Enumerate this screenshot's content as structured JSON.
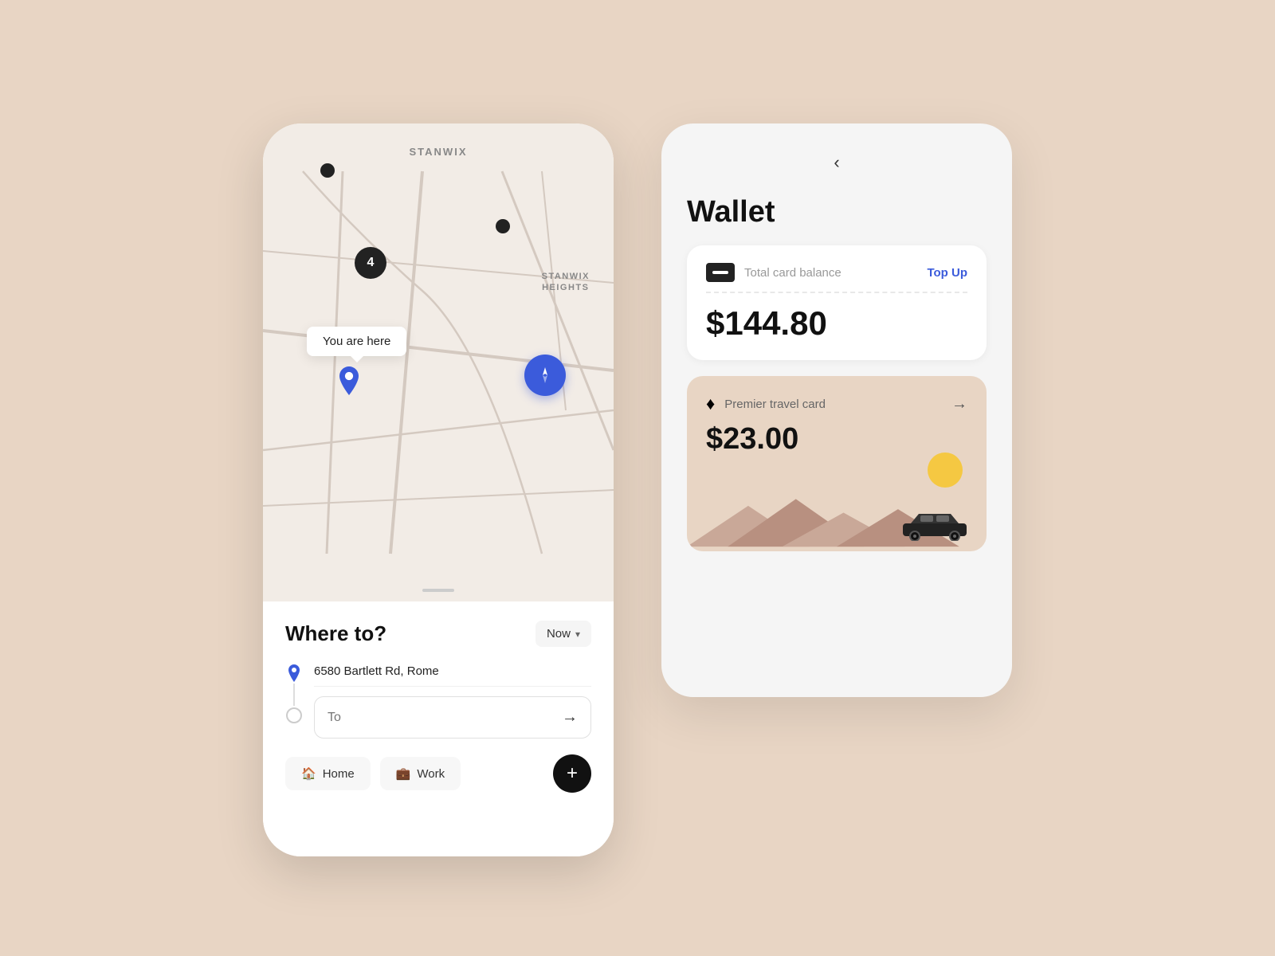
{
  "background_color": "#e8d5c4",
  "left_phone": {
    "map": {
      "stanwix_label": "STANWIX",
      "stanwix_heights_label": "STANWIX\nHEIGHTS",
      "map_number": "4",
      "you_are_here_label": "You are here"
    },
    "bottom": {
      "title": "Where to?",
      "now_button_label": "Now",
      "address_from": "6580 Bartlett Rd, Rome",
      "address_to_placeholder": "To",
      "home_label": "Home",
      "work_label": "Work",
      "plus_label": "+"
    }
  },
  "right_wallet": {
    "back_label": "‹",
    "title": "Wallet",
    "balance_card": {
      "label": "Total card balance",
      "top_up_label": "Top Up",
      "amount": "$144.80"
    },
    "travel_card": {
      "label": "Premier travel card",
      "amount": "$23.00",
      "arrow": "→"
    }
  }
}
